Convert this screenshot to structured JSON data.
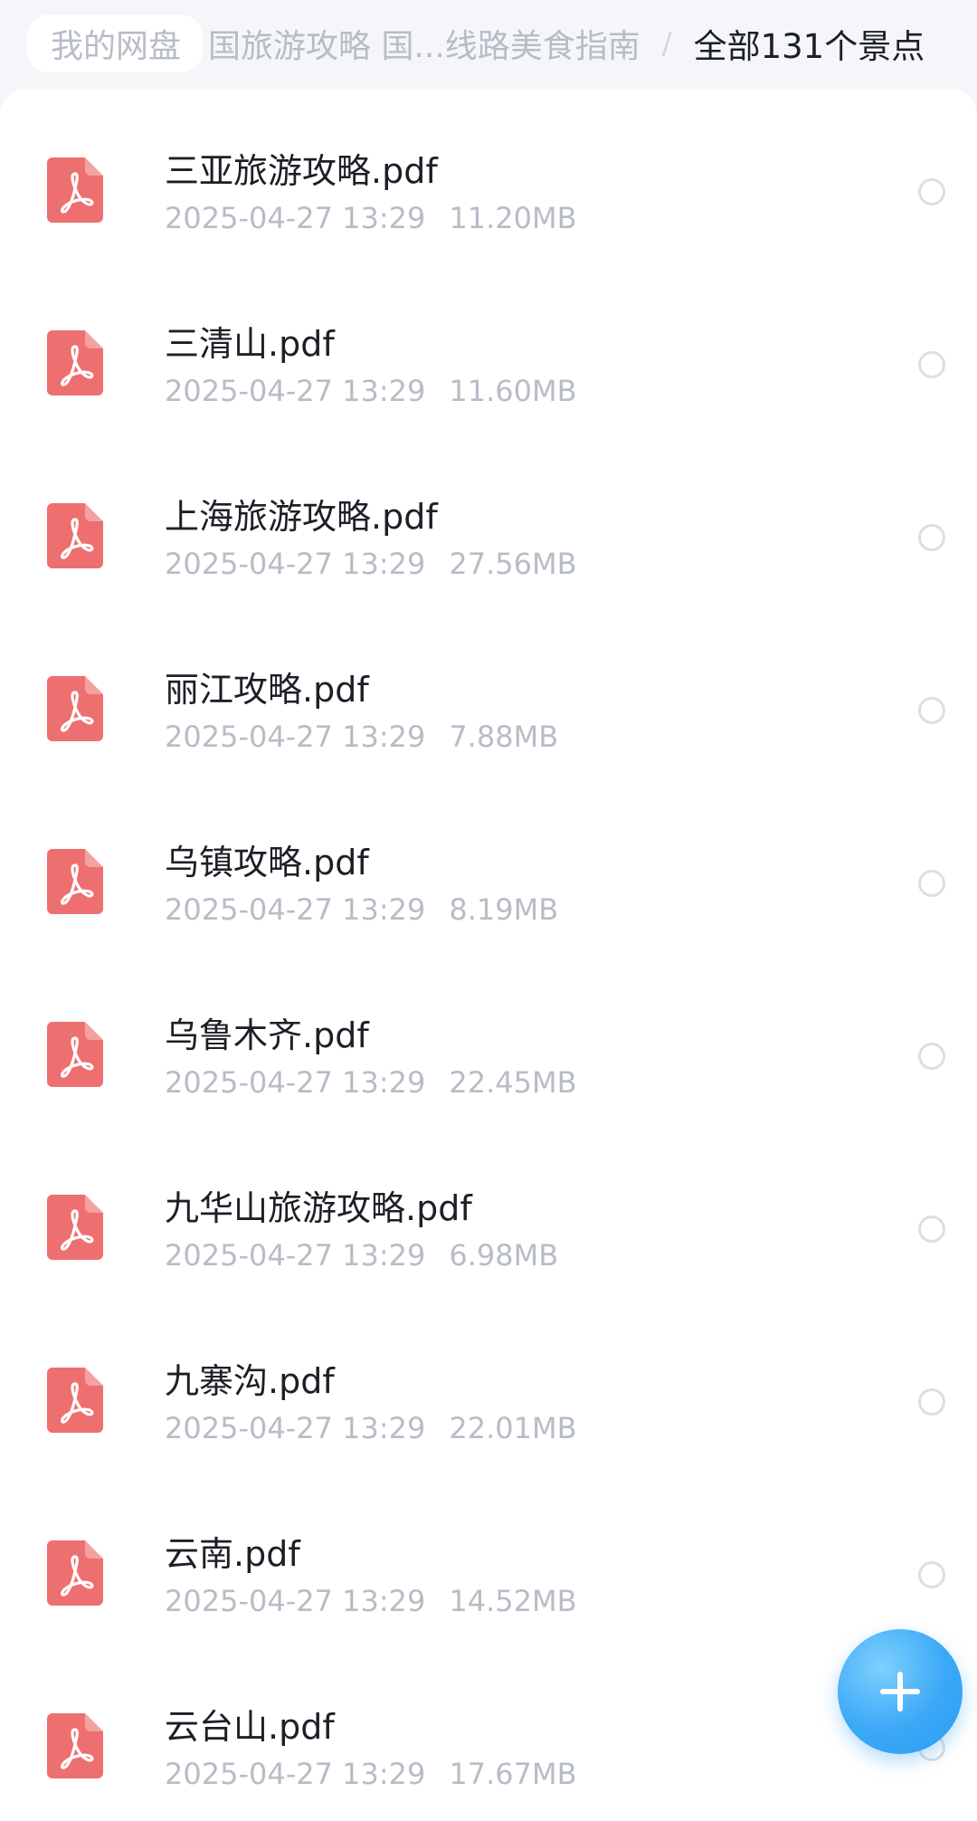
{
  "breadcrumb": {
    "root": "我的网盘",
    "middle": "国旅游攻略 国...线路美食指南",
    "separator": "/",
    "current": "全部131个景点"
  },
  "files": [
    {
      "name": "三亚旅游攻略.pdf",
      "date": "2025-04-27  13:29",
      "size": "11.20MB",
      "icon": "pdf-icon"
    },
    {
      "name": "三清山.pdf",
      "date": "2025-04-27  13:29",
      "size": "11.60MB",
      "icon": "pdf-icon"
    },
    {
      "name": "上海旅游攻略.pdf",
      "date": "2025-04-27  13:29",
      "size": "27.56MB",
      "icon": "pdf-icon"
    },
    {
      "name": "丽江攻略.pdf",
      "date": "2025-04-27  13:29",
      "size": "7.88MB",
      "icon": "pdf-icon"
    },
    {
      "name": "乌镇攻略.pdf",
      "date": "2025-04-27  13:29",
      "size": "8.19MB",
      "icon": "pdf-icon"
    },
    {
      "name": "乌鲁木齐.pdf",
      "date": "2025-04-27  13:29",
      "size": "22.45MB",
      "icon": "pdf-icon"
    },
    {
      "name": "九华山旅游攻略.pdf",
      "date": "2025-04-27  13:29",
      "size": "6.98MB",
      "icon": "pdf-icon"
    },
    {
      "name": "九寨沟.pdf",
      "date": "2025-04-27  13:29",
      "size": "22.01MB",
      "icon": "pdf-icon"
    },
    {
      "name": "云南.pdf",
      "date": "2025-04-27  13:29",
      "size": "14.52MB",
      "icon": "pdf-icon"
    },
    {
      "name": "云台山.pdf",
      "date": "2025-04-27  13:29",
      "size": "17.67MB",
      "icon": "pdf-icon"
    }
  ],
  "fab": {
    "icon": "plus-icon"
  },
  "colors": {
    "pdf_icon": "#ee6f6f",
    "accent_blue": "#3aa8f7",
    "text_primary": "#1c1f26",
    "text_secondary": "#b8bcc6"
  }
}
